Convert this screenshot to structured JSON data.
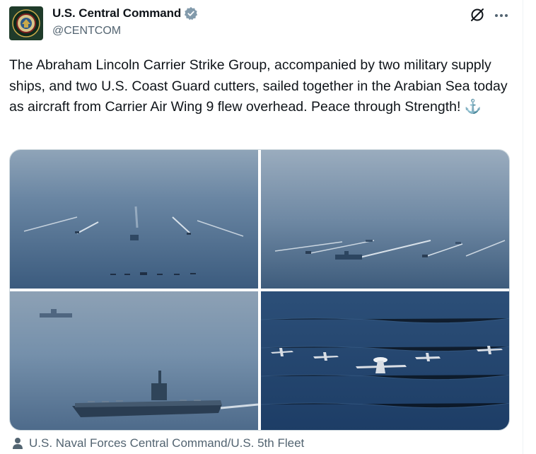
{
  "author": {
    "display_name": "U.S. Central Command",
    "handle": "@CENTCOM",
    "verified": true
  },
  "header_actions": {
    "grok_icon": "grok-slash-circle-icon",
    "more_icon": "more-horizontal-icon"
  },
  "tweet": {
    "text": "The Abraham Lincoln Carrier Strike Group, accompanied by two military supply ships, and two U.S. Coast Guard cutters, sailed together in the Arabian Sea today as aircraft from Carrier Air Wing 9 flew overhead. Peace through Strength! ",
    "emoji": "⚓"
  },
  "media": {
    "count": 4,
    "images": [
      {
        "subject": "ships-in-formation-haze"
      },
      {
        "subject": "carrier-strike-group-line"
      },
      {
        "subject": "aircraft-carrier-closeup"
      },
      {
        "subject": "aircraft-formation-over-sea"
      }
    ]
  },
  "media_credit": "U.S. Naval Forces Central Command/U.S. 5th Fleet",
  "colors": {
    "text": "#0f1419",
    "secondary": "#536471",
    "verified_badge": "#829aab",
    "sea": "#3c5f86"
  }
}
